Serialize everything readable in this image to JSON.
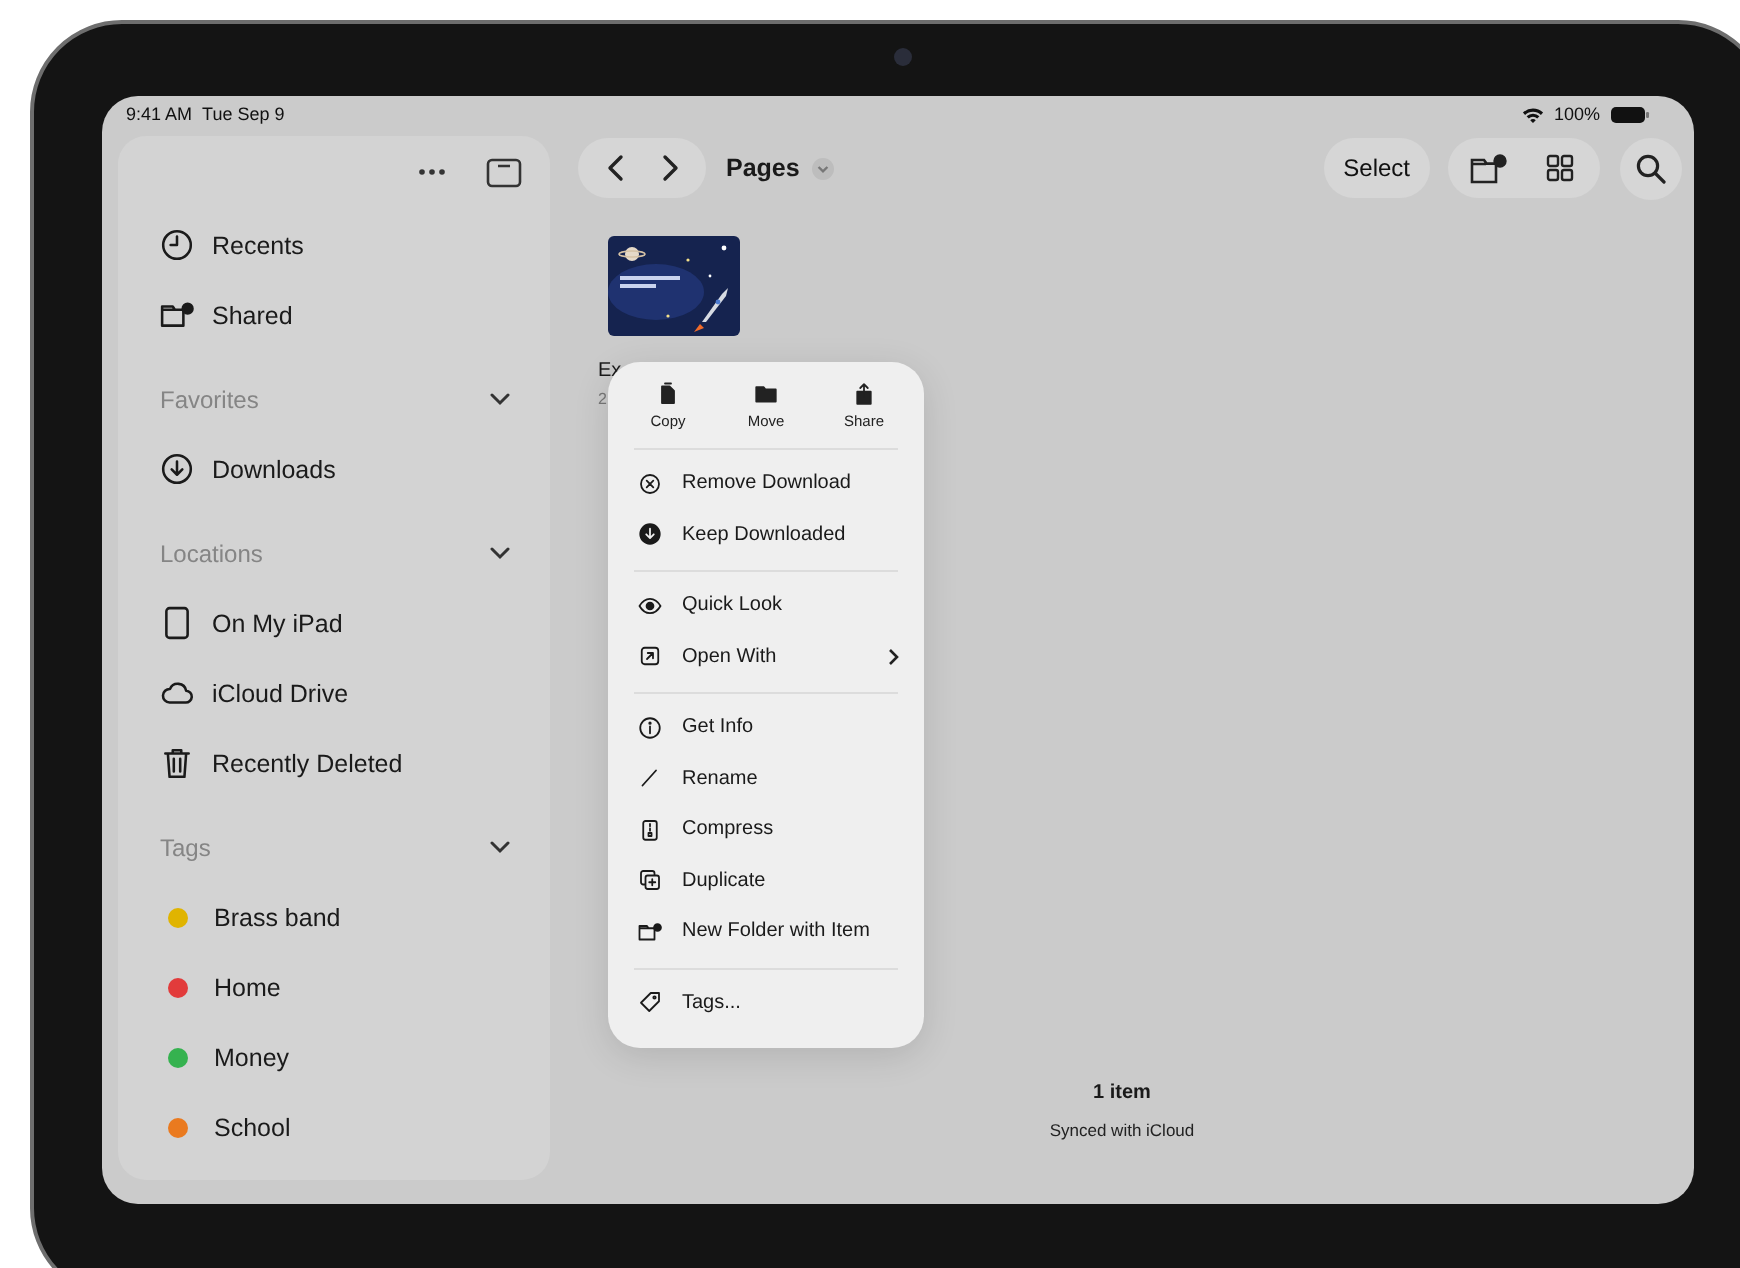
{
  "status_bar": {
    "time": "9:41 AM",
    "date": "Tue Sep 9",
    "battery": "100%"
  },
  "sidebar": {
    "sections": [
      {
        "items": [
          {
            "label": "Recents"
          },
          {
            "label": "Shared"
          }
        ]
      },
      {
        "title": "Favorites",
        "expanded": true,
        "items": [
          {
            "label": "Downloads"
          }
        ]
      },
      {
        "title": "Locations",
        "expanded": true,
        "items": [
          {
            "label": "On My iPad"
          },
          {
            "label": "iCloud Drive"
          },
          {
            "label": "Recently Deleted"
          }
        ]
      },
      {
        "title": "Tags",
        "expanded": true,
        "items": [
          {
            "label": "Brass band",
            "color": "#e0b400"
          },
          {
            "label": "Home",
            "color": "#e23b3b"
          },
          {
            "label": "Money",
            "color": "#35b24f"
          },
          {
            "label": "School",
            "color": "#ea7a1f"
          }
        ]
      }
    ]
  },
  "toolbar": {
    "title": "Pages",
    "select": "Select"
  },
  "files": [
    {
      "kind": "picture",
      "name": "Ex",
      "detail": "2"
    }
  ],
  "context_menu": {
    "actions": [
      {
        "label": "Copy"
      },
      {
        "label": "Move"
      },
      {
        "label": "Share"
      }
    ],
    "groups": [
      [
        {
          "label": "Remove Download"
        },
        {
          "label": "Keep Downloaded"
        }
      ],
      [
        {
          "label": "Quick Look"
        },
        {
          "label": "Open With",
          "submenu": true
        }
      ],
      [
        {
          "label": "Get Info"
        },
        {
          "label": "Rename"
        },
        {
          "label": "Compress"
        },
        {
          "label": "Duplicate"
        },
        {
          "label": "New Folder with Item"
        }
      ],
      [
        {
          "label": "Tags..."
        }
      ]
    ]
  },
  "footer": {
    "count": "1 item",
    "status": "Synced with iCloud"
  }
}
